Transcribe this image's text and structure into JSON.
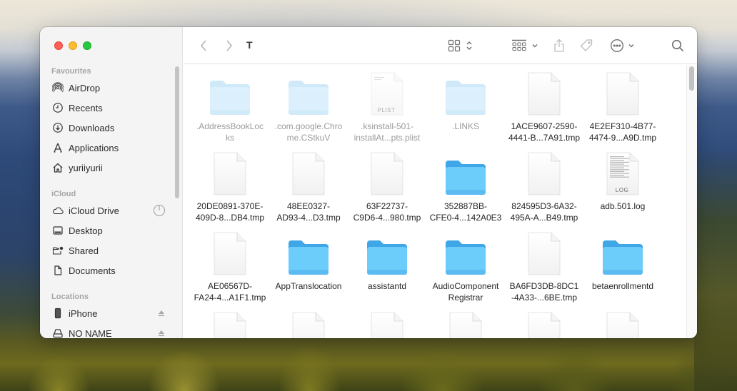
{
  "window": {
    "current_folder": "T",
    "traffic_lights": [
      "close",
      "minimize",
      "maximize"
    ]
  },
  "colors": {
    "folder": "#5ac8fa",
    "close": "#fe5f57",
    "minimize": "#febc2e",
    "maximize": "#28c840"
  },
  "sidebar": {
    "sections": [
      {
        "title": "Favourites",
        "items": [
          {
            "label": "AirDrop",
            "icon": "airdrop-icon"
          },
          {
            "label": "Recents",
            "icon": "clock-icon"
          },
          {
            "label": "Downloads",
            "icon": "download-icon"
          },
          {
            "label": "Applications",
            "icon": "applications-icon"
          },
          {
            "label": "yuriiyurii",
            "icon": "home-icon"
          }
        ]
      },
      {
        "title": "iCloud",
        "items": [
          {
            "label": "iCloud Drive",
            "icon": "cloud-icon",
            "trailing": "sync-progress-icon"
          },
          {
            "label": "Desktop",
            "icon": "desktop-icon"
          },
          {
            "label": "Shared",
            "icon": "shared-folder-icon"
          },
          {
            "label": "Documents",
            "icon": "document-icon"
          }
        ]
      },
      {
        "title": "Locations",
        "items": [
          {
            "label": "iPhone",
            "icon": "iphone-icon",
            "trailing": "eject-icon"
          },
          {
            "label": "NO NAME",
            "icon": "drive-icon",
            "trailing": "eject-icon"
          }
        ]
      }
    ]
  },
  "toolbar": {
    "back": "back-icon",
    "forward": "forward-icon",
    "view_mode": "icon-view-icon",
    "group": "group-icon",
    "share": "share-icon",
    "tag": "tag-icon",
    "more": "more-icon",
    "search": "search-icon"
  },
  "files": [
    {
      "name": ".AddressBookLocks",
      "label_lines": [
        ".AddressBookLoc",
        "ks"
      ],
      "type": "folder",
      "hidden": true
    },
    {
      "name": ".com.google.Chrome.CStkuV",
      "label_lines": [
        ".com.google.Chro",
        "me.CStkuV"
      ],
      "type": "folder",
      "hidden": true
    },
    {
      "name": ".ksinstall-501-installAt...pts.plist",
      "label_lines": [
        ".ksinstall-501-",
        "installAt...pts.plist"
      ],
      "type": "plist",
      "badge": "PLIST",
      "hidden": true
    },
    {
      "name": ".LINKS",
      "label_lines": [
        ".LINKS"
      ],
      "type": "folder",
      "hidden": true
    },
    {
      "name": "1ACE9607-2590-4441-B...7A91.tmp",
      "label_lines": [
        "1ACE9607-2590-",
        "4441-B...7A91.tmp"
      ],
      "type": "file"
    },
    {
      "name": "4E2EF310-4B77-4474-9...A9D.tmp",
      "label_lines": [
        "4E2EF310-4B77-",
        "4474-9...A9D.tmp"
      ],
      "type": "file"
    },
    {
      "name": "20DE0891-370E-409D-8...DB4.tmp",
      "label_lines": [
        "20DE0891-370E-",
        "409D-8...DB4.tmp"
      ],
      "type": "file"
    },
    {
      "name": "48EE0327-AD93-4...D3.tmp",
      "label_lines": [
        "48EE0327-",
        "AD93-4...D3.tmp"
      ],
      "type": "file"
    },
    {
      "name": "63F22737-C9D6-4...980.tmp",
      "label_lines": [
        "63F22737-",
        "C9D6-4...980.tmp"
      ],
      "type": "file"
    },
    {
      "name": "352887BB-CFE0-4...142A0E3",
      "label_lines": [
        "352887BB-",
        "CFE0-4...142A0E3"
      ],
      "type": "folder"
    },
    {
      "name": "824595D3-6A32-495A-A...B49.tmp",
      "label_lines": [
        "824595D3-6A32-",
        "495A-A...B49.tmp"
      ],
      "type": "file"
    },
    {
      "name": "adb.501.log",
      "label_lines": [
        "adb.501.log"
      ],
      "type": "log",
      "badge": "LOG"
    },
    {
      "name": "AE06567D-FA24-4...A1F1.tmp",
      "label_lines": [
        "AE06567D-",
        "FA24-4...A1F1.tmp"
      ],
      "type": "file"
    },
    {
      "name": "AppTranslocation",
      "label_lines": [
        "AppTranslocation"
      ],
      "type": "folder"
    },
    {
      "name": "assistantd",
      "label_lines": [
        "assistantd"
      ],
      "type": "folder"
    },
    {
      "name": "AudioComponentRegistrar",
      "label_lines": [
        "AudioComponent",
        "Registrar"
      ],
      "type": "folder"
    },
    {
      "name": "BA6FD3DB-8DC1-4A33-...6BE.tmp",
      "label_lines": [
        "BA6FD3DB-8DC1",
        "-4A33-...6BE.tmp"
      ],
      "type": "file"
    },
    {
      "name": "betaenrollmentd",
      "label_lines": [
        "betaenrollmentd"
      ],
      "type": "folder"
    },
    {
      "name": "",
      "label_lines": [],
      "type": "file"
    },
    {
      "name": "",
      "label_lines": [],
      "type": "file"
    },
    {
      "name": "",
      "label_lines": [],
      "type": "file"
    },
    {
      "name": "",
      "label_lines": [],
      "type": "file"
    },
    {
      "name": "",
      "label_lines": [],
      "type": "file"
    },
    {
      "name": "",
      "label_lines": [],
      "type": "file"
    }
  ]
}
